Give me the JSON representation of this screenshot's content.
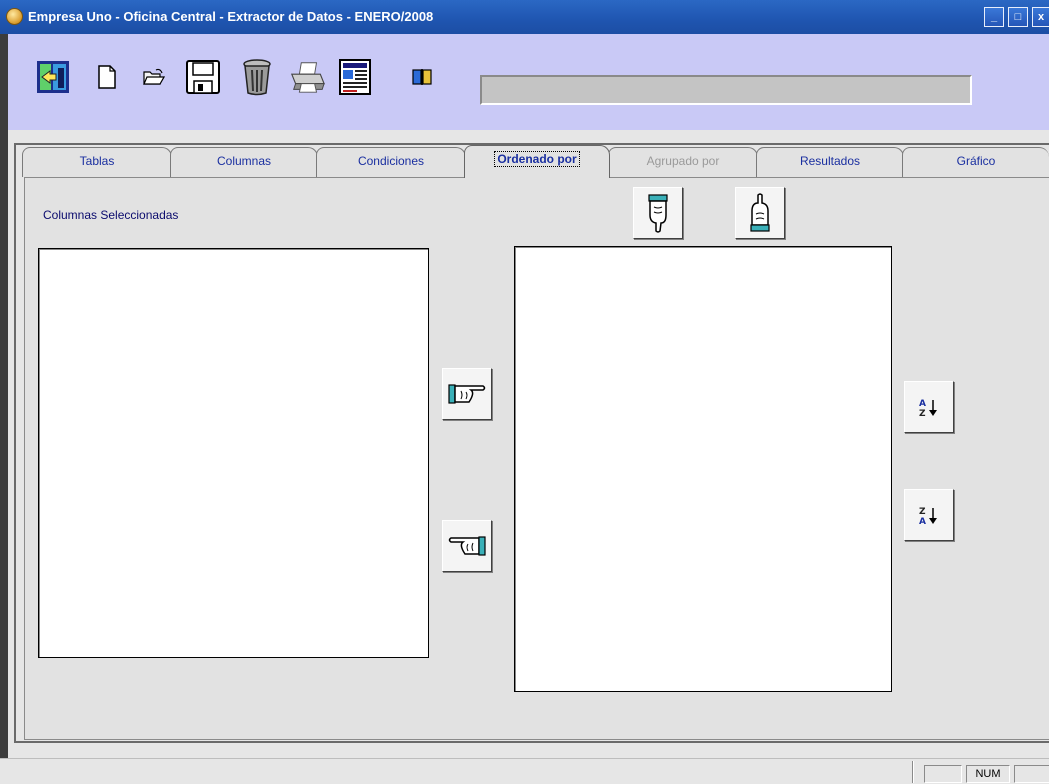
{
  "window": {
    "title": "Empresa Uno - Oficina Central - Extractor de Datos - ENERO/2008",
    "controls": {
      "minimize": "_",
      "maximize": "□",
      "close": "x"
    }
  },
  "toolbar": {
    "buttons": [
      {
        "name": "exit-icon",
        "tooltip_visible": false
      },
      {
        "name": "new-document-icon"
      },
      {
        "name": "open-folder-icon"
      },
      {
        "name": "save-disk-icon"
      },
      {
        "name": "trash-icon"
      },
      {
        "name": "print-icon"
      },
      {
        "name": "report-icon"
      },
      {
        "name": "book-icon"
      }
    ],
    "progress": 0
  },
  "tabs": [
    {
      "label": "Tablas",
      "state": "normal"
    },
    {
      "label": "Columnas",
      "state": "normal"
    },
    {
      "label": "Condiciones",
      "state": "normal"
    },
    {
      "label": "Ordenado por",
      "state": "active"
    },
    {
      "label": "Agrupado por",
      "state": "disabled"
    },
    {
      "label": "Resultados",
      "state": "normal"
    },
    {
      "label": "Gráfico",
      "state": "normal"
    }
  ],
  "ordenado": {
    "selected_columns_label": "Columnas Seleccionadas",
    "selected_columns": [],
    "order_columns": [],
    "buttons": {
      "move_down": "hand-pointing-down-icon",
      "move_up": "hand-pointing-up-icon",
      "add": "hand-pointing-right-icon",
      "remove": "hand-pointing-left-icon",
      "sort_asc": "A↓Z",
      "sort_desc": "Z↓A"
    }
  },
  "statusbar": {
    "panes": [
      "",
      "NUM",
      ""
    ]
  },
  "colors": {
    "titlebar": "#1f55b0",
    "toolbar_bg": "#c9c9f6",
    "tab_text": "#1a2fa0",
    "label_text": "#0b0b6e"
  }
}
